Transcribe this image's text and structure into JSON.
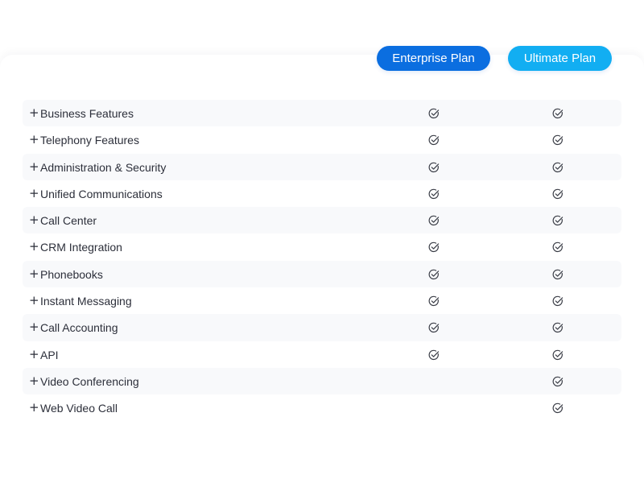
{
  "plans": {
    "enterprise_label": "Enterprise Plan",
    "ultimate_label": "Ultimate Plan"
  },
  "colors": {
    "enterprise_button": "#0b6ee0",
    "ultimate_button": "#12aef2",
    "check_stroke": "#3a3d46"
  },
  "expand_symbol": "+",
  "features": [
    {
      "label": "Business Features",
      "enterprise": true,
      "ultimate": true
    },
    {
      "label": "Telephony Features",
      "enterprise": true,
      "ultimate": true
    },
    {
      "label": "Administration & Security",
      "enterprise": true,
      "ultimate": true
    },
    {
      "label": "Unified Communications",
      "enterprise": true,
      "ultimate": true
    },
    {
      "label": "Call Center",
      "enterprise": true,
      "ultimate": true
    },
    {
      "label": "CRM Integration",
      "enterprise": true,
      "ultimate": true
    },
    {
      "label": "Phonebooks",
      "enterprise": true,
      "ultimate": true
    },
    {
      "label": "Instant Messaging",
      "enterprise": true,
      "ultimate": true
    },
    {
      "label": "Call Accounting",
      "enterprise": true,
      "ultimate": true
    },
    {
      "label": "API",
      "enterprise": true,
      "ultimate": true
    },
    {
      "label": "Video Conferencing",
      "enterprise": false,
      "ultimate": true
    },
    {
      "label": "Web Video Call",
      "enterprise": false,
      "ultimate": true
    }
  ]
}
